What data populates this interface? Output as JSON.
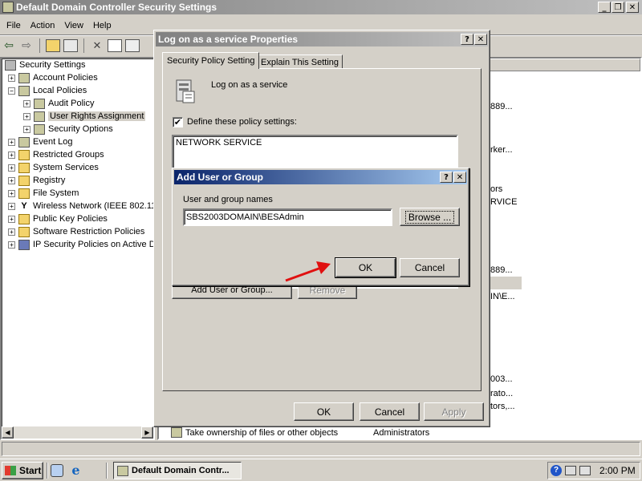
{
  "main_window": {
    "title": "Default Domain Controller Security Settings",
    "menu": [
      "File",
      "Action",
      "View",
      "Help"
    ],
    "tree": [
      {
        "label": "Security Settings",
        "level": 0
      },
      {
        "label": "Account Policies",
        "level": 1
      },
      {
        "label": "Local Policies",
        "level": 1
      },
      {
        "label": "Audit Policy",
        "level": 2
      },
      {
        "label": "User Rights Assignment",
        "level": 2
      },
      {
        "label": "Security Options",
        "level": 2
      },
      {
        "label": "Event Log",
        "level": 1
      },
      {
        "label": "Restricted Groups",
        "level": 1
      },
      {
        "label": "System Services",
        "level": 1
      },
      {
        "label": "Registry",
        "level": 1
      },
      {
        "label": "File System",
        "level": 1
      },
      {
        "label": "Wireless Network (IEEE 802.11",
        "level": 1
      },
      {
        "label": "Public Key Policies",
        "level": 1
      },
      {
        "label": "Software Restriction Policies",
        "level": 1
      },
      {
        "label": "IP Security Policies on Active D",
        "level": 1
      }
    ],
    "right_fragments": [
      "889...",
      "rker...",
      "ors",
      "RVICE",
      "889...",
      "IN\\E...",
      "003...",
      "rato...",
      "tors,..."
    ],
    "bottom_row": {
      "policy": "Take ownership of files or other objects",
      "setting": "Administrators"
    }
  },
  "properties_dialog": {
    "title": "Log on as a service Properties",
    "tabs": [
      "Security Policy Setting",
      "Explain This Setting"
    ],
    "policy_name": "Log on as a service",
    "define_label": "Define these policy settings:",
    "define_checked": true,
    "members": [
      "NETWORK SERVICE"
    ],
    "add_button": "Add User or Group...",
    "remove_button": "Remove",
    "ok": "OK",
    "cancel": "Cancel",
    "apply": "Apply"
  },
  "add_dialog": {
    "title": "Add User or Group",
    "label": "User and group names",
    "value": "SBS2003DOMAIN\\BESAdmin",
    "browse": "Browse ...",
    "ok": "OK",
    "cancel": "Cancel"
  },
  "taskbar": {
    "start": "Start",
    "task": "Default Domain Contr...",
    "clock": "2:00 PM"
  },
  "colors": {
    "annotation_arrow": "#e01010",
    "title_active": "#0a246a"
  }
}
